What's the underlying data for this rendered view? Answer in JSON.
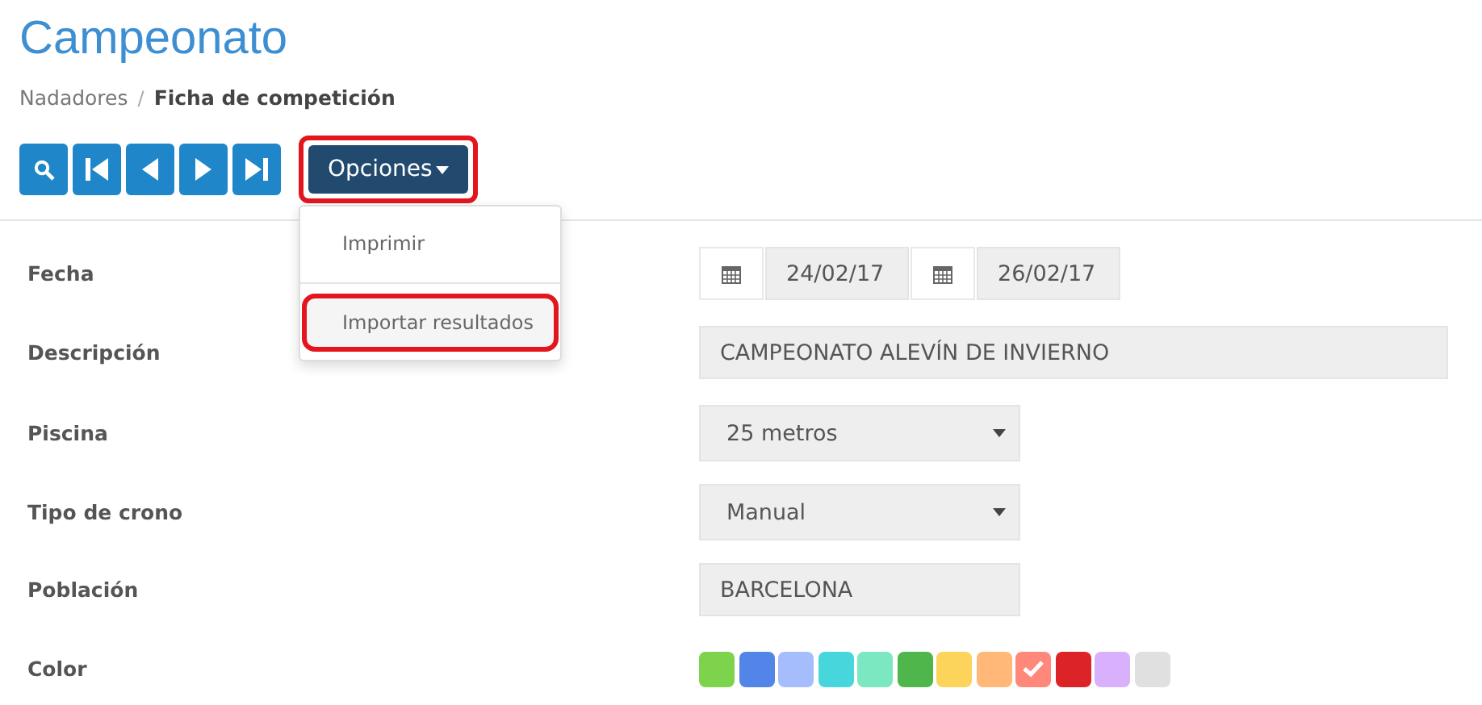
{
  "title": "Campeonato",
  "breadcrumb_separator": "/",
  "breadcrumb": [
    {
      "label": "Nadadores",
      "current": false
    },
    {
      "label": "Ficha de competición",
      "current": true
    }
  ],
  "toolbar": {
    "nav_buttons": [
      {
        "kind": "search"
      },
      {
        "kind": "first"
      },
      {
        "kind": "prev"
      },
      {
        "kind": "next"
      },
      {
        "kind": "last"
      }
    ],
    "options_button": {
      "label": "Opciones",
      "highlighted": true
    }
  },
  "dropdown": {
    "items": [
      {
        "label": "Imprimir",
        "highlighted": false
      },
      {
        "label": "Importar resultados",
        "highlighted": true
      }
    ]
  },
  "form": [
    {
      "label": "Fecha",
      "kind": "dates",
      "values": [
        "24/02/17",
        "26/02/17"
      ]
    },
    {
      "label": "Descripción",
      "kind": "text",
      "value": "CAMPEONATO ALEVÍN DE INVIERNO",
      "wide": true
    },
    {
      "label": "Piscina",
      "kind": "select",
      "value": "25 metros"
    },
    {
      "label": "Tipo de crono",
      "kind": "select",
      "value": "Manual"
    },
    {
      "label": "Población",
      "kind": "text",
      "value": "BARCELONA",
      "wide": false
    },
    {
      "label": "Color",
      "kind": "colors",
      "colors": [
        {
          "color": "#7ed34c",
          "selected": false
        },
        {
          "color": "#5385e8",
          "selected": false
        },
        {
          "color": "#a5bdfc",
          "selected": false
        },
        {
          "color": "#48d6dd",
          "selected": false
        },
        {
          "color": "#7ce8c1",
          "selected": false
        },
        {
          "color": "#4fb64b",
          "selected": false
        },
        {
          "color": "#fcd45c",
          "selected": false
        },
        {
          "color": "#ffb877",
          "selected": false
        },
        {
          "color": "#ff887b",
          "selected": true
        },
        {
          "color": "#dc2328",
          "selected": false
        },
        {
          "color": "#d9b0fc",
          "selected": false
        },
        {
          "color": "#e0e0e0",
          "selected": false
        }
      ]
    }
  ]
}
